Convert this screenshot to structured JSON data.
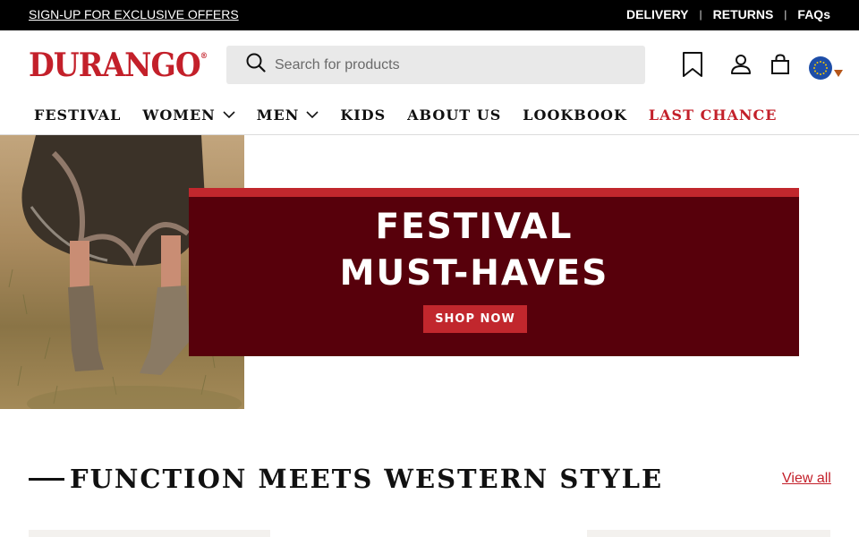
{
  "topbar": {
    "promo": "SIGN-UP FOR EXCLUSIVE OFFERS",
    "links": [
      {
        "label": "DELIVERY"
      },
      {
        "label": "RETURNS"
      },
      {
        "label": "FAQs"
      }
    ],
    "separator": "|"
  },
  "header": {
    "logo": "DURANGO",
    "logo_mark": "®",
    "search_placeholder": "Search for products",
    "icons": [
      "search-icon",
      "bookmark-icon",
      "account-icon",
      "bag-icon",
      "eu-flag-icon",
      "caret-down-icon"
    ]
  },
  "nav": {
    "items": [
      {
        "label": "FESTIVAL"
      },
      {
        "label": "WOMEN"
      },
      {
        "label": "MEN"
      },
      {
        "label": "KIDS"
      },
      {
        "label": "ABOUT US"
      },
      {
        "label": "LOOKBOOK"
      },
      {
        "label": "LAST CHANCE"
      }
    ]
  },
  "hero": {
    "title_line1": "FESTIVAL",
    "title_line2": "MUST-HAVES",
    "cta": "SHOP NOW"
  },
  "section": {
    "title": "FUNCTION MEETS WESTERN STYLE",
    "view_all": "View all"
  },
  "colors": {
    "brand_red": "#c3202a",
    "banner_maroon": "#57000b",
    "banner_red": "#c1272d",
    "topbar_bg": "#000000",
    "search_bg": "#e9e9e9"
  }
}
